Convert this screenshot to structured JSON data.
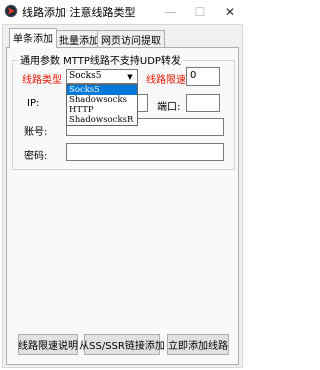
{
  "window": {
    "title": "线路添加 注意线路类型",
    "minimize_icon": "—",
    "maximize_icon": "☐",
    "close_icon": "✕"
  },
  "tabs": [
    {
      "label": "单条添加"
    },
    {
      "label": "批量添加"
    },
    {
      "label": "网页访问提取"
    }
  ],
  "group": {
    "title": "通用参数  MTTP线路不支持UDP转发"
  },
  "form": {
    "line_type_label": "线路类型",
    "line_type_value": "Socks5",
    "line_type_options": [
      "Socks5",
      "Shadowsocks",
      "HTTP",
      "ShadowsocksR"
    ],
    "limit_label": "线路限速",
    "limit_value": "0",
    "ip_label": "IP:",
    "ip_value": "",
    "port_label": "端口:",
    "port_value": "",
    "account_label": "账号:",
    "account_value": "",
    "password_label": "密码:",
    "password_value": ""
  },
  "buttons": {
    "limit_help": "线路限速说明",
    "from_link": "从SS/SSR链接添加",
    "add_now": "立即添加线路"
  },
  "colors": {
    "required_label": "#e51400",
    "selection": "#0078d7"
  }
}
